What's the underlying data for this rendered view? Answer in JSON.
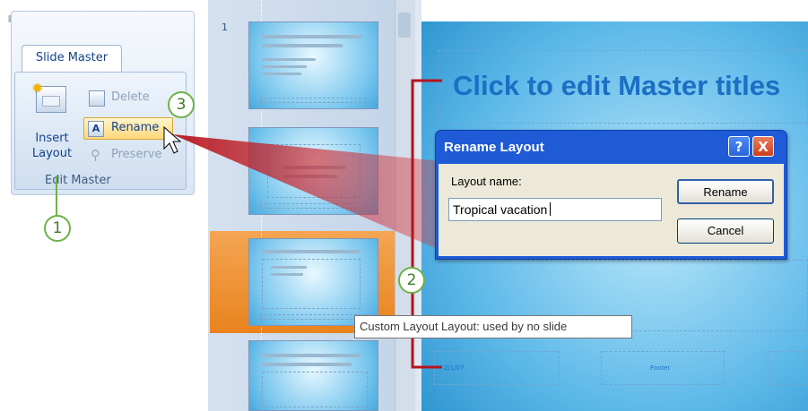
{
  "ribbon": {
    "tab_label": "Slide Master",
    "insert_layout_label": "Insert\nLayout",
    "delete_label": "Delete",
    "rename_label": "Rename",
    "preserve_label": "Preserve",
    "group_label": "Edit Master"
  },
  "callouts": {
    "one": "1",
    "two": "2",
    "three": "3"
  },
  "thumbnails": {
    "first_slide_number": "1"
  },
  "slide": {
    "title_placeholder": "Click to edit Master titles",
    "footer_date": "2/1/07",
    "footer_text": "Footer"
  },
  "dialog": {
    "title": "Rename Layout",
    "help_glyph": "?",
    "close_glyph": "X",
    "field_label": "Layout name:",
    "field_value": "Tropical vacation",
    "rename_button": "Rename",
    "cancel_button": "Cancel"
  },
  "tooltip": "Custom Layout Layout: used by no slide",
  "colors": {
    "callout_green": "#6db247",
    "arrow_red": "#c0191f",
    "selected_orange": "#e9831e",
    "dialog_blue": "#1f5bd6"
  }
}
